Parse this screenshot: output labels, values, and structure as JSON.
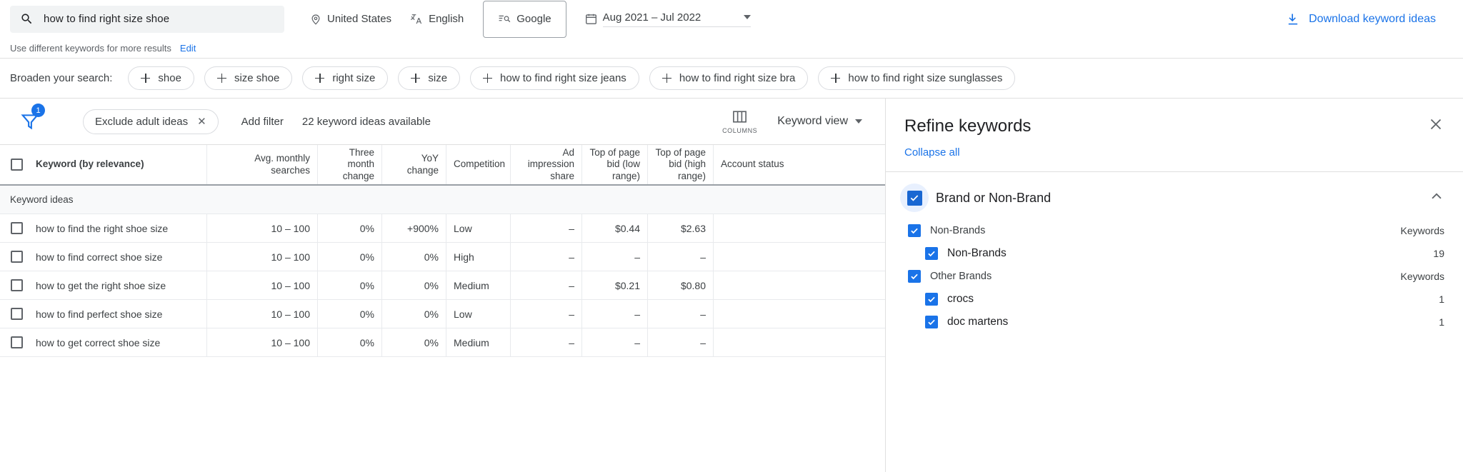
{
  "topbar": {
    "search_value": "how to find right size shoe",
    "search_placeholder": "Search",
    "location": "United States",
    "language": "English",
    "network": "Google",
    "date_range": "Aug 2021 – Jul 2022",
    "download_label": "Download keyword ideas"
  },
  "subbar": {
    "hint": "Use different keywords for more results",
    "edit_label": "Edit"
  },
  "broaden": {
    "label": "Broaden your search:",
    "chips": [
      "shoe",
      "size shoe",
      "right size",
      "size",
      "how to find right size jeans",
      "how to find right size bra",
      "how to find right size sunglasses"
    ]
  },
  "filterbar": {
    "filter_badge": "1",
    "active_filter": "Exclude adult ideas",
    "remove_filter_glyph": "✕",
    "add_filter_label": "Add filter",
    "idea_count": "22 keyword ideas available",
    "columns_label": "COLUMNS",
    "view_label": "Keyword view"
  },
  "table": {
    "columns": [
      "Keyword (by relevance)",
      "Avg. monthly searches",
      "Three month change",
      "YoY change",
      "Competition",
      "Ad impression share",
      "Top of page bid (low range)",
      "Top of page bid (high range)",
      "Account status"
    ],
    "group_label": "Keyword ideas",
    "rows": [
      {
        "keyword": "how to find the right shoe size",
        "avg": "10 – 100",
        "three_month": "0%",
        "yoy": "+900%",
        "competition": "Low",
        "ad_share": "–",
        "bid_low": "$0.44",
        "bid_high": "$2.63",
        "account_status": ""
      },
      {
        "keyword": "how to find correct shoe size",
        "avg": "10 – 100",
        "three_month": "0%",
        "yoy": "0%",
        "competition": "High",
        "ad_share": "–",
        "bid_low": "–",
        "bid_high": "–",
        "account_status": ""
      },
      {
        "keyword": "how to get the right shoe size",
        "avg": "10 – 100",
        "three_month": "0%",
        "yoy": "0%",
        "competition": "Medium",
        "ad_share": "–",
        "bid_low": "$0.21",
        "bid_high": "$0.80",
        "account_status": ""
      },
      {
        "keyword": "how to find perfect shoe size",
        "avg": "10 – 100",
        "three_month": "0%",
        "yoy": "0%",
        "competition": "Low",
        "ad_share": "–",
        "bid_low": "–",
        "bid_high": "–",
        "account_status": ""
      },
      {
        "keyword": "how to get correct shoe size",
        "avg": "10 – 100",
        "three_month": "0%",
        "yoy": "0%",
        "competition": "Medium",
        "ad_share": "–",
        "bid_low": "–",
        "bid_high": "–",
        "account_status": ""
      }
    ]
  },
  "refine": {
    "title": "Refine keywords",
    "close_glyph": "✕",
    "collapse_all": "Collapse all",
    "group": {
      "label": "Brand or Non-Brand",
      "rows": [
        {
          "label": "Non-Brands",
          "value": "Keywords",
          "level": 1
        },
        {
          "label": "Non-Brands",
          "value": "19",
          "level": 2
        },
        {
          "label": "Other Brands",
          "value": "Keywords",
          "level": 1
        },
        {
          "label": "crocs",
          "value": "1",
          "level": 2
        },
        {
          "label": "doc martens",
          "value": "1",
          "level": 2
        }
      ]
    }
  },
  "colors": {
    "accent": "#1a73e8",
    "checkbox": "#1967d2",
    "text": "#202124",
    "muted": "#5f6368",
    "border": "#e0e0e0",
    "search_bg": "#f1f3f4",
    "group_bg": "#f8f9fa"
  }
}
